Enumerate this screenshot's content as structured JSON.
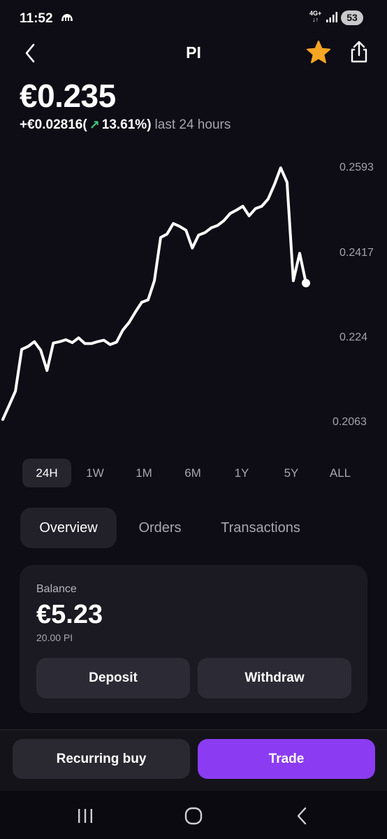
{
  "status_bar": {
    "time": "11:52",
    "network_top": "4G+",
    "battery": "53",
    "notification_icon": "cloud-icon",
    "signal_icon": "signal-icon"
  },
  "header": {
    "title": "PI",
    "back_icon": "back-chevron-icon",
    "favorite_icon": "star-icon",
    "share_icon": "share-icon"
  },
  "price": {
    "value": "€0.235",
    "change_amount": "+€0.02816",
    "paren_open": "(",
    "change_percent": "13.61%",
    "paren_close": ")",
    "period": "last 24 hours",
    "change_icon": "arrow-up-right-icon"
  },
  "chart_data": {
    "type": "line",
    "series": [
      {
        "x": [
          0,
          0.5,
          1,
          1.5,
          2,
          2.5,
          3,
          3.5,
          4,
          4.5,
          5,
          5.5,
          6,
          6.5,
          7,
          7.5,
          8,
          8.5,
          9,
          9.5,
          10,
          10.5,
          11,
          11.5,
          12,
          12.5,
          13,
          13.5,
          14,
          14.5,
          15,
          15.5,
          16,
          16.5,
          17,
          17.5,
          18,
          18.5,
          19,
          19.5,
          20,
          20.5,
          21,
          21.5,
          22,
          22.5,
          23,
          23.5,
          24
        ],
        "values": [
          0.2066,
          0.2095,
          0.2125,
          0.2212,
          0.2218,
          0.2228,
          0.221,
          0.2168,
          0.2225,
          0.2228,
          0.2232,
          0.2226,
          0.2236,
          0.2224,
          0.2224,
          0.2228,
          0.2231,
          0.2222,
          0.2227,
          0.2252,
          0.2268,
          0.229,
          0.231,
          0.2315,
          0.2355,
          0.2445,
          0.2452,
          0.2474,
          0.2468,
          0.246,
          0.2423,
          0.245,
          0.2455,
          0.2465,
          0.247,
          0.248,
          0.2495,
          0.2502,
          0.251,
          0.249,
          0.2505,
          0.251,
          0.2525,
          0.2555,
          0.259,
          0.256,
          0.2355,
          0.2412,
          0.235
        ]
      }
    ],
    "y_ticks": [
      "0.2593",
      "0.2417",
      "0.224",
      "0.2063"
    ],
    "ylim": [
      0.2063,
      0.2593
    ],
    "grid": false,
    "line_color": "#ffffff",
    "background": "#0e0c14"
  },
  "ranges": [
    "24H",
    "1W",
    "1M",
    "6M",
    "1Y",
    "5Y",
    "ALL"
  ],
  "tabs": [
    "Overview",
    "Orders",
    "Transactions"
  ],
  "balance": {
    "label": "Balance",
    "value": "€5.23",
    "units": "20.00 PI",
    "deposit_label": "Deposit",
    "withdraw_label": "Withdraw"
  },
  "actions": {
    "recurring_label": "Recurring buy",
    "trade_label": "Trade"
  },
  "colors": {
    "accent": "#8b3cf2",
    "positive": "#3ccf7c",
    "star": "#f5a623"
  }
}
